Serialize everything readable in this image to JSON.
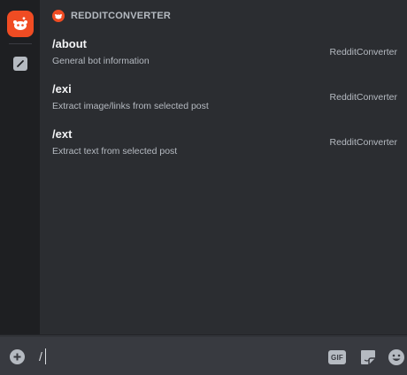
{
  "rail": {
    "app_icon": "reddit-converter-app-icon",
    "slash_icon": "slash-command-icon"
  },
  "section": {
    "title": "REDDITCONVERTER",
    "icon": "reddit-alien-icon"
  },
  "commands": [
    {
      "name": "/about",
      "description": "General bot information",
      "source": "RedditConverter"
    },
    {
      "name": "/exi",
      "description": "Extract image/links from selected post",
      "source": "RedditConverter"
    },
    {
      "name": "/ext",
      "description": "Extract text from selected post",
      "source": "RedditConverter"
    }
  ],
  "input": {
    "value": "/",
    "add_icon": "plus-circle-icon",
    "gif_label": "GIF",
    "sticker_icon": "sticker-icon",
    "emoji_icon": "emoji-icon"
  },
  "colors": {
    "accent": "#f04c23",
    "background": "#2b2d31",
    "rail": "#1e1f22",
    "input": "#383a40"
  }
}
